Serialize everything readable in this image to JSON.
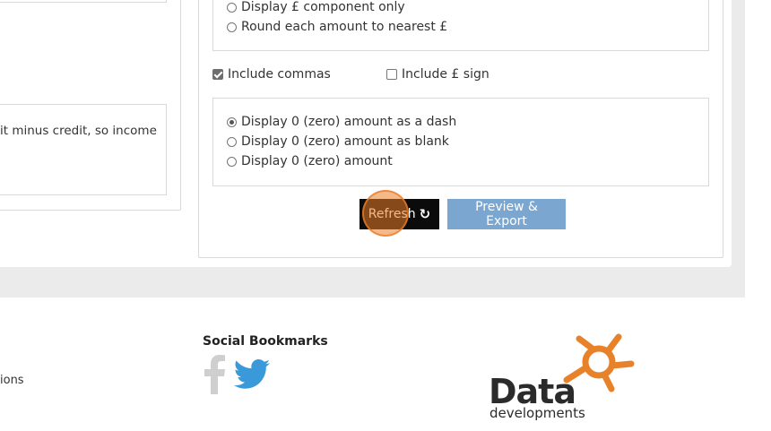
{
  "left_panel": {
    "note_text": "it minus credit, so income"
  },
  "amount_options": {
    "display_pound_component": "Display £ component only",
    "round_nearest": "Round each amount to nearest £"
  },
  "format_checkboxes": {
    "include_commas": "Include commas",
    "include_commas_checked": true,
    "include_pound_sign": "Include £ sign",
    "include_pound_sign_checked": false
  },
  "zero_options": {
    "items": [
      {
        "label": "Display 0 (zero) amount as a dash",
        "selected": true
      },
      {
        "label": "Display 0 (zero) amount as blank",
        "selected": false
      },
      {
        "label": "Display 0 (zero) amount",
        "selected": false
      }
    ]
  },
  "actions": {
    "refresh_label": "Refresh",
    "preview_export_label": "Preview & Export"
  },
  "footer": {
    "left_partial_text": "ions",
    "social_title": "Social Bookmarks",
    "logo_word": "Data",
    "logo_sub": "developments"
  },
  "colors": {
    "refresh_bg": "#0b0b0b",
    "preview_bg": "#7aa6cf",
    "twitter_blue": "#3a9ad9",
    "logo_orange": "#e8822a"
  }
}
